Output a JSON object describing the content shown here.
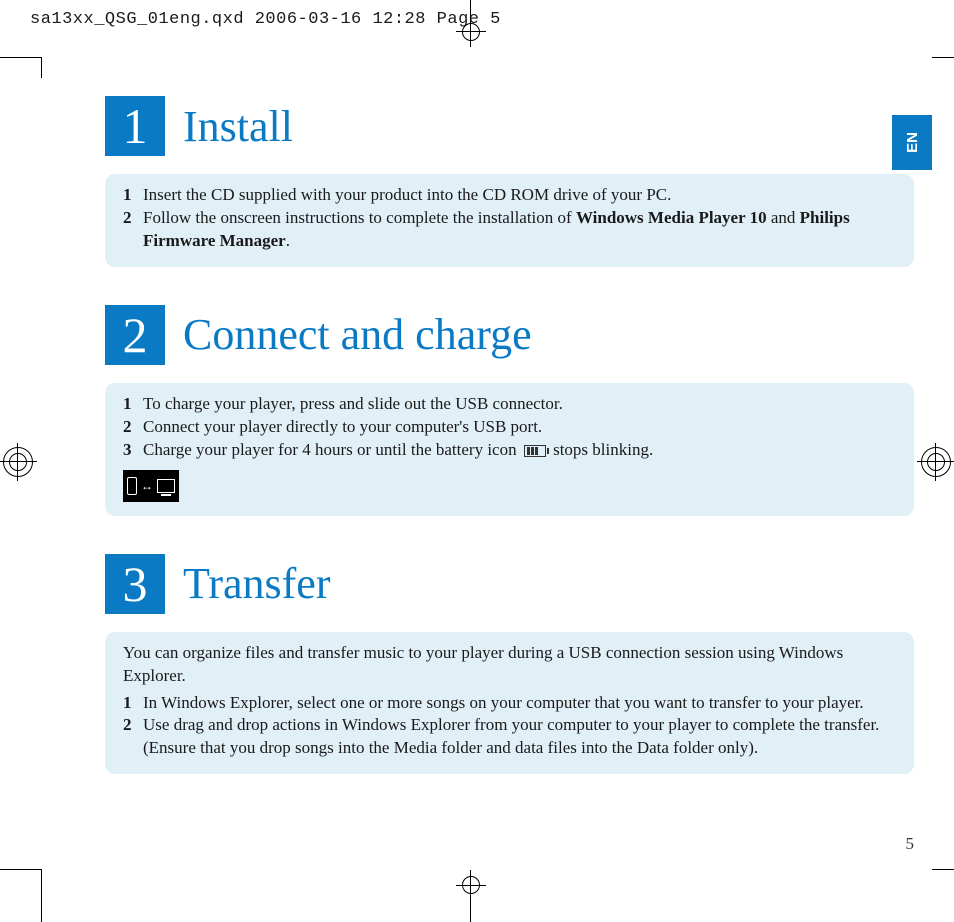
{
  "header_line": "sa13xx_QSG_01eng.qxd  2006-03-16  12:28  Page 5",
  "lang_tab": "EN",
  "page_number": "5",
  "sections": {
    "install": {
      "num": "1",
      "title": "Install",
      "steps": [
        {
          "n": "1",
          "text_a": "Insert the CD supplied with your product into the CD ROM drive of your PC."
        },
        {
          "n": "2",
          "text_a": "Follow the onscreen instructions to complete the installation of ",
          "bold1": "Windows Media Player 10",
          "mid": " and ",
          "bold2": "Philips Firmware Manager",
          "tail": "."
        }
      ]
    },
    "connect": {
      "num": "2",
      "title": "Connect and charge",
      "steps": [
        {
          "n": "1",
          "text": "To charge your player, press and slide out the USB connector."
        },
        {
          "n": "2",
          "text": "Connect your player directly to your computer's USB port."
        },
        {
          "n": "3",
          "pre": "Charge your player for 4 hours or until the battery icon ",
          "post": " stops blinking."
        }
      ]
    },
    "transfer": {
      "num": "3",
      "title": "Transfer",
      "intro": "You can organize files and transfer music to your player during a USB connection session using Windows Explorer.",
      "steps": [
        {
          "n": "1",
          "text": "In Windows Explorer, select one or more songs on your computer that you want to transfer to your player."
        },
        {
          "n": "2",
          "text": "Use drag and drop actions in Windows Explorer from your computer to your player  to complete the transfer. (Ensure that you drop songs into the Media folder and data files into the Data folder only)."
        }
      ]
    }
  }
}
